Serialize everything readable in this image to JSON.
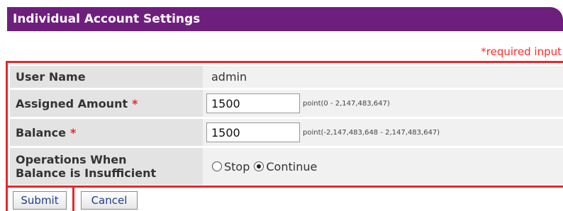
{
  "header": {
    "title": "Individual Account Settings"
  },
  "required_note": "*required input",
  "form": {
    "user_name": {
      "label": "User Name",
      "value": "admin"
    },
    "assigned_amount": {
      "label": "Assigned Amount",
      "required_mark": "*",
      "value": "1500",
      "hint": "point(0 - 2,147,483,647)"
    },
    "balance": {
      "label": "Balance",
      "required_mark": "*",
      "value": "1500",
      "hint": "point(-2,147,483,648 - 2,147,483,647)"
    },
    "operations": {
      "label_line1": "Operations When",
      "label_line2": "Balance is Insufficient",
      "options": [
        {
          "label": "Stop",
          "checked": false
        },
        {
          "label": "Continue",
          "checked": true
        }
      ]
    }
  },
  "buttons": {
    "submit": "Submit",
    "cancel": "Cancel"
  },
  "colors": {
    "header_bg": "#6e1f7d",
    "required": "#e8262a",
    "link_text": "#1f3d8a"
  }
}
